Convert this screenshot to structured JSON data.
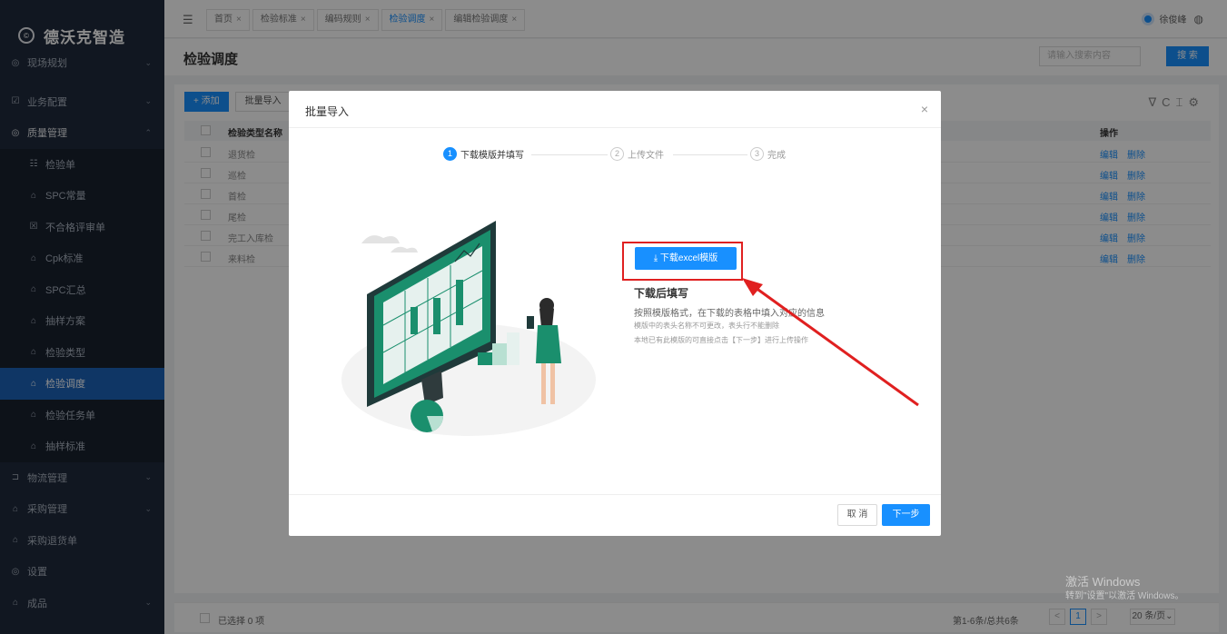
{
  "sidebar": {
    "logo_mark": "©",
    "logo": "德沃克智造",
    "items": [
      {
        "icon": "◎",
        "label": "现场规划",
        "chev": "⌄"
      },
      {
        "icon": "☑",
        "label": "业务配置",
        "chev": "⌄"
      },
      {
        "icon": "◎",
        "label": "质量管理",
        "chev": "⌃"
      },
      {
        "icon": "☷",
        "label": "检验单"
      },
      {
        "icon": "⌂",
        "label": "SPC常量"
      },
      {
        "icon": "☒",
        "label": "不合格评审单"
      },
      {
        "icon": "⌂",
        "label": "Cpk标准"
      },
      {
        "icon": "⌂",
        "label": "SPC汇总"
      },
      {
        "icon": "⌂",
        "label": "抽样方案"
      },
      {
        "icon": "⌂",
        "label": "检验类型"
      },
      {
        "icon": "⌂",
        "label": "检验调度"
      },
      {
        "icon": "⌂",
        "label": "检验任务单"
      },
      {
        "icon": "⌂",
        "label": "抽样标准"
      },
      {
        "icon": "⊐",
        "label": "物流管理",
        "chev": "⌄"
      },
      {
        "icon": "⌂",
        "label": "采购管理",
        "chev": "⌄"
      },
      {
        "icon": "⌂",
        "label": "采购退货单"
      },
      {
        "icon": "◎",
        "label": "设置"
      },
      {
        "icon": "⌂",
        "label": "成品",
        "chev": "⌄"
      }
    ]
  },
  "topbar": {
    "menu_toggle": "☰",
    "tabs": [
      {
        "label": "首页",
        "x": "×"
      },
      {
        "label": "检验标准",
        "x": "×"
      },
      {
        "label": "编码规则",
        "x": "×"
      },
      {
        "label": "检验调度",
        "x": "×"
      },
      {
        "label": "编辑检验调度",
        "x": "×"
      }
    ],
    "user": "徐俊峰",
    "globe": "◍"
  },
  "page": {
    "title": "检验调度",
    "search_placeholder": "请输入搜索内容",
    "search_btn": "搜 索"
  },
  "toolbar": {
    "add": "+ 添加",
    "import": "批量导入",
    "tool_icons": "∇C⌶⚙"
  },
  "table": {
    "col_name": "检验类型名称",
    "col_op": "操作",
    "rows": [
      {
        "name": "退货检",
        "edit": "编辑",
        "del": "删除"
      },
      {
        "name": "巡检",
        "edit": "编辑",
        "del": "删除"
      },
      {
        "name": "首检",
        "edit": "编辑",
        "del": "删除"
      },
      {
        "name": "尾检",
        "edit": "编辑",
        "del": "删除"
      },
      {
        "name": "完工入库检",
        "edit": "编辑",
        "del": "删除"
      },
      {
        "name": "来料检",
        "edit": "编辑",
        "del": "删除"
      }
    ]
  },
  "footer": {
    "selected": "已选择 0 项",
    "total": "第1-6条/总共6条",
    "prev": "<",
    "page": "1",
    "next": ">",
    "page_size": "20 条/页⌄"
  },
  "watermark": {
    "line1": "激活 Windows",
    "line2": "转到\"设置\"以激活 Windows。"
  },
  "modal": {
    "title": "批量导入",
    "close": "×",
    "steps": [
      {
        "num": "1",
        "label": "下载模版并填写"
      },
      {
        "num": "2",
        "label": "上传文件"
      },
      {
        "num": "3",
        "label": "完成"
      }
    ],
    "download_btn": "⤓ 下载excel模版",
    "info_title": "下载后填写",
    "info_line1": "按照模版格式，在下载的表格中填入对应的信息",
    "info_line2": "模版中的表头名称不可更改，表头行不能删除",
    "info_line3": "本地已有此模版的可直接点击【下一步】进行上传操作",
    "cancel": "取 消",
    "next": "下一步"
  },
  "colors": {
    "primary": "#1890ff",
    "sidebar_bg": "#1f2a3c",
    "sidebar_active": "#1d63b8",
    "highlight": "#e02020",
    "illustration_teal": "#1a8f6d"
  }
}
